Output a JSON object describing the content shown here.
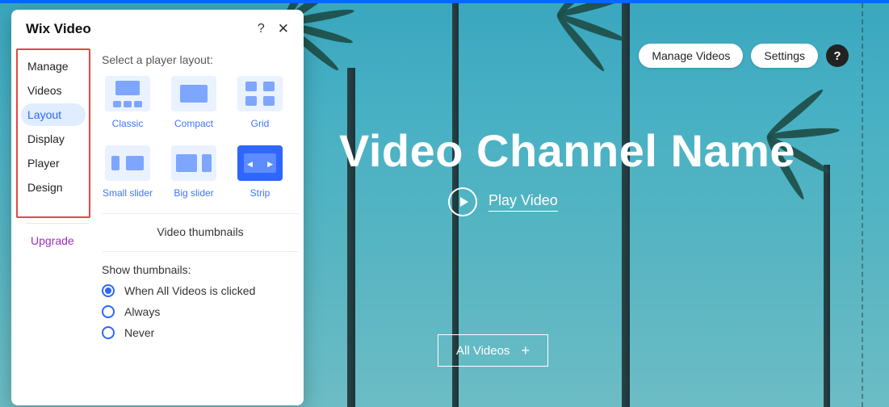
{
  "panel": {
    "title": "Wix Video",
    "help_icon": "?",
    "close_icon": "✕",
    "sidebar": {
      "items": [
        {
          "label": "Manage"
        },
        {
          "label": "Videos"
        },
        {
          "label": "Layout"
        },
        {
          "label": "Display"
        },
        {
          "label": "Player"
        },
        {
          "label": "Design"
        }
      ],
      "active_index": 2,
      "upgrade_label": "Upgrade"
    },
    "layout_section": {
      "prompt": "Select a player layout:",
      "options": [
        {
          "label": "Classic"
        },
        {
          "label": "Compact"
        },
        {
          "label": "Grid"
        },
        {
          "label": "Small slider"
        },
        {
          "label": "Big slider"
        },
        {
          "label": "Strip"
        }
      ],
      "selected_index": 5
    },
    "thumbnails_section": {
      "heading": "Video thumbnails",
      "label": "Show thumbnails:",
      "options": [
        {
          "label": "When All Videos is clicked"
        },
        {
          "label": "Always"
        },
        {
          "label": "Never"
        }
      ],
      "selected_index": 0
    }
  },
  "canvas": {
    "manage_videos_label": "Manage Videos",
    "settings_label": "Settings",
    "help_icon": "?",
    "hero_title": "Video Channel Name",
    "play_label": "Play Video",
    "all_videos_label": "All Videos",
    "plus_icon": "+"
  }
}
